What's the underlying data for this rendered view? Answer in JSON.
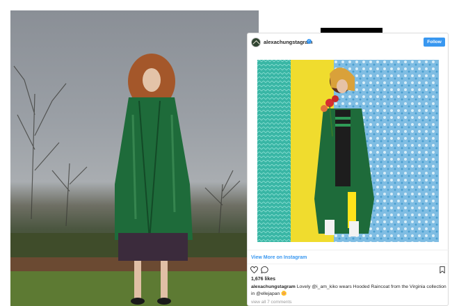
{
  "instagram_post": {
    "username": "alexachungstagram",
    "follow_label": "Follow",
    "verified_icon": "✓",
    "view_more_label": "View More on Instagram",
    "likes": "1,676 likes",
    "caption_user": "alexachungstagram",
    "caption_text": " Lovely @i_am_kiko wears Hooded Raincoat from the Virginia collection in @ellejapan 🌼",
    "view_comments": "view all 7 comments"
  },
  "icons": {
    "heart": "heart-icon",
    "comment": "comment-icon",
    "bookmark": "bookmark-icon"
  },
  "colors": {
    "accent": "#3897f0",
    "raincoat_green": "#1e6b3a",
    "wall_yellow": "#f0dc2e",
    "wall_blue_pattern": "#8fc6e6",
    "curtain_teal": "#3fbfae"
  }
}
